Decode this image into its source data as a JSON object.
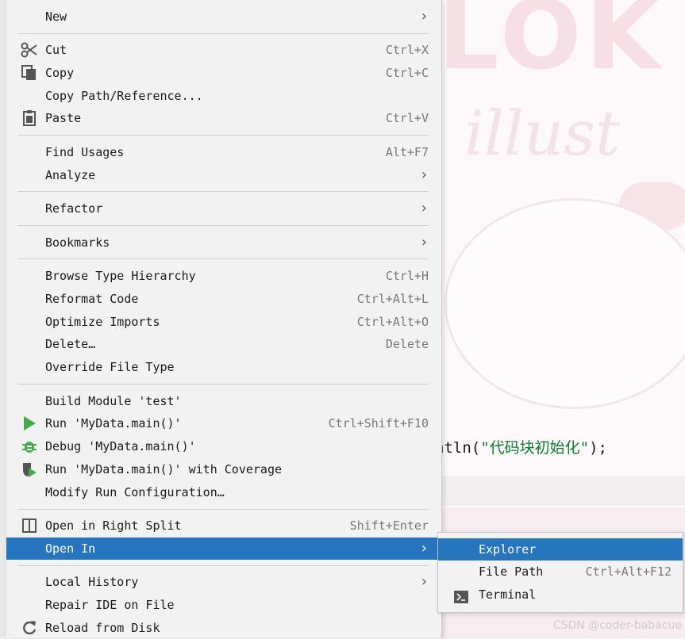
{
  "background": {
    "code_text_prefix": "ntln(",
    "code_string": "\"代码块初始化\"",
    "code_text_suffix": ");",
    "watermark": "CSDN @coder-babacue"
  },
  "menu": {
    "items": [
      {
        "label": "New",
        "shortcut": "",
        "has_submenu": true,
        "icon": ""
      },
      {
        "label": "Cut",
        "shortcut": "Ctrl+X",
        "has_submenu": false,
        "icon": "scissors-icon"
      },
      {
        "label": "Copy",
        "shortcut": "Ctrl+C",
        "has_submenu": false,
        "icon": "copy-icon"
      },
      {
        "label": "Copy Path/Reference...",
        "shortcut": "",
        "has_submenu": false,
        "icon": ""
      },
      {
        "label": "Paste",
        "shortcut": "Ctrl+V",
        "has_submenu": false,
        "icon": "clipboard-icon"
      },
      {
        "label": "Find Usages",
        "shortcut": "Alt+F7",
        "has_submenu": false,
        "icon": ""
      },
      {
        "label": "Analyze",
        "shortcut": "",
        "has_submenu": true,
        "icon": ""
      },
      {
        "label": "Refactor",
        "shortcut": "",
        "has_submenu": true,
        "icon": ""
      },
      {
        "label": "Bookmarks",
        "shortcut": "",
        "has_submenu": true,
        "icon": ""
      },
      {
        "label": "Browse Type Hierarchy",
        "shortcut": "Ctrl+H",
        "has_submenu": false,
        "icon": ""
      },
      {
        "label": "Reformat Code",
        "shortcut": "Ctrl+Alt+L",
        "has_submenu": false,
        "icon": ""
      },
      {
        "label": "Optimize Imports",
        "shortcut": "Ctrl+Alt+O",
        "has_submenu": false,
        "icon": ""
      },
      {
        "label": "Delete…",
        "shortcut": "Delete",
        "has_submenu": false,
        "icon": ""
      },
      {
        "label": "Override File Type",
        "shortcut": "",
        "has_submenu": false,
        "icon": ""
      },
      {
        "label": "Build Module 'test'",
        "shortcut": "",
        "has_submenu": false,
        "icon": ""
      },
      {
        "label": "Run 'MyData.main()'",
        "shortcut": "Ctrl+Shift+F10",
        "has_submenu": false,
        "icon": "run-icon"
      },
      {
        "label": "Debug 'MyData.main()'",
        "shortcut": "",
        "has_submenu": false,
        "icon": "debug-icon"
      },
      {
        "label": "Run 'MyData.main()' with Coverage",
        "shortcut": "",
        "has_submenu": false,
        "icon": "coverage-icon"
      },
      {
        "label": "Modify Run Configuration…",
        "shortcut": "",
        "has_submenu": false,
        "icon": ""
      },
      {
        "label": "Open in Right Split",
        "shortcut": "Shift+Enter",
        "has_submenu": false,
        "icon": "split-icon"
      },
      {
        "label": "Open In",
        "shortcut": "",
        "has_submenu": true,
        "icon": "",
        "selected": true
      },
      {
        "label": "Local History",
        "shortcut": "",
        "has_submenu": true,
        "icon": ""
      },
      {
        "label": "Repair IDE on File",
        "shortcut": "",
        "has_submenu": false,
        "icon": ""
      },
      {
        "label": "Reload from Disk",
        "shortcut": "",
        "has_submenu": false,
        "icon": "reload-icon"
      }
    ]
  },
  "submenu": {
    "items": [
      {
        "label": "Explorer",
        "shortcut": "",
        "selected": true,
        "icon": ""
      },
      {
        "label": "File Path",
        "shortcut": "Ctrl+Alt+F12",
        "icon": ""
      },
      {
        "label": "Terminal",
        "shortcut": "",
        "icon": "terminal-icon"
      }
    ]
  },
  "colors": {
    "selection": "#2675bf",
    "run_green": "#4aa84f"
  }
}
